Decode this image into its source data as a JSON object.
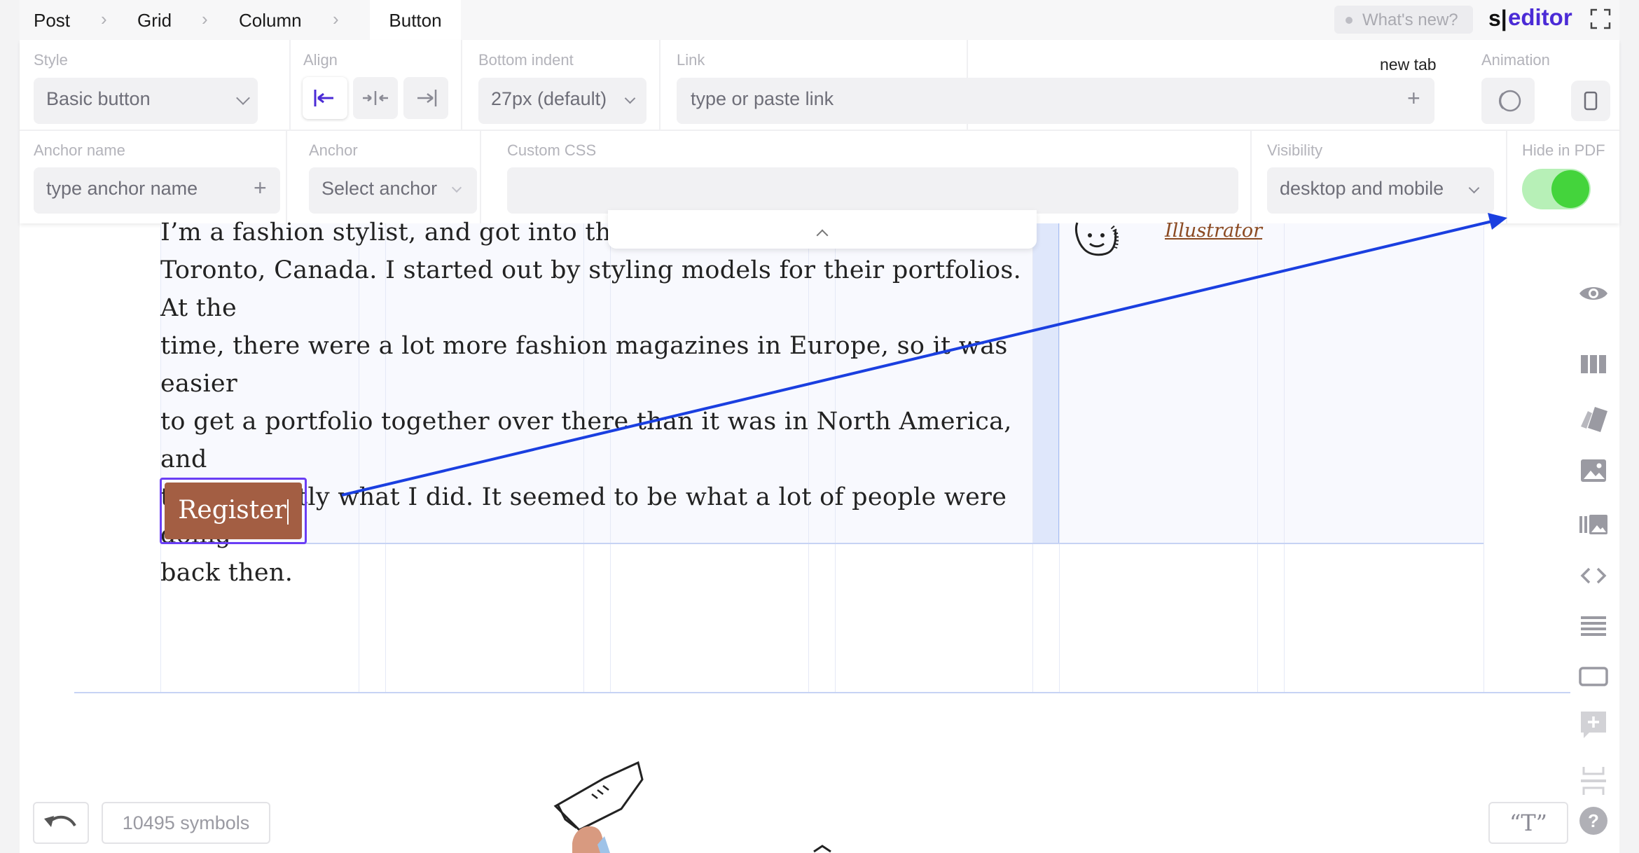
{
  "breadcrumb": {
    "items": [
      {
        "label": "Post"
      },
      {
        "label": "Grid"
      },
      {
        "label": "Column"
      },
      {
        "label": "Button"
      }
    ],
    "separator": "›"
  },
  "header": {
    "whats_new": "What's new?",
    "logo_s": "s|",
    "logo_editor": "editor"
  },
  "toolbar": {
    "style": {
      "label": "Style",
      "value": "Basic button"
    },
    "align": {
      "label": "Align",
      "options": [
        "left",
        "center",
        "right"
      ],
      "selected": "left"
    },
    "bottom_indent": {
      "label": "Bottom indent",
      "value": "27px (default)"
    },
    "link": {
      "label": "Link",
      "placeholder": "type or paste link",
      "new_tab_label": "new tab",
      "new_tab_checked": true
    },
    "animation": {
      "label": "Animation"
    },
    "anchor_name": {
      "label": "Anchor name",
      "placeholder": "type anchor name"
    },
    "anchor": {
      "label": "Anchor",
      "value": "Select anchor"
    },
    "custom_css": {
      "label": "Custom CSS",
      "value": ""
    },
    "visibility": {
      "label": "Visibility",
      "value": "desktop and mobile"
    },
    "hide_in_pdf": {
      "label": "Hide in PDF",
      "on": true
    }
  },
  "article": {
    "line1": "I’m a fashion stylist, and got into the b",
    "line2": "Toronto, Canada. I started out by styling models for their portfolios. At the",
    "line3": "time, there were a lot more fashion magazines in Europe, so it was easier",
    "line4": "to get a portfolio together over there than it was in North America, and",
    "line5": "that’s exactly what I did. It seemed to be what a lot of people were doing",
    "line6": "back then.",
    "illustrator_link": "Illustrator",
    "button_label": "Register",
    "button_color": "#a35e43"
  },
  "sidebar": {
    "icons": [
      "eye-icon",
      "columns-icon",
      "cards-icon",
      "image-icon",
      "gallery-icon",
      "code-icon",
      "text-lines-icon",
      "button-block-icon",
      "add-block-icon",
      "divider-icon",
      "help-icon"
    ]
  },
  "footer": {
    "symbols": "10495 symbols",
    "quote_button": "“T”"
  },
  "colors": {
    "accent": "#4b2bd6",
    "arrow": "#1a3fe0",
    "toggle_on": "#44d43c",
    "checkbox": "#2d7bf0"
  }
}
